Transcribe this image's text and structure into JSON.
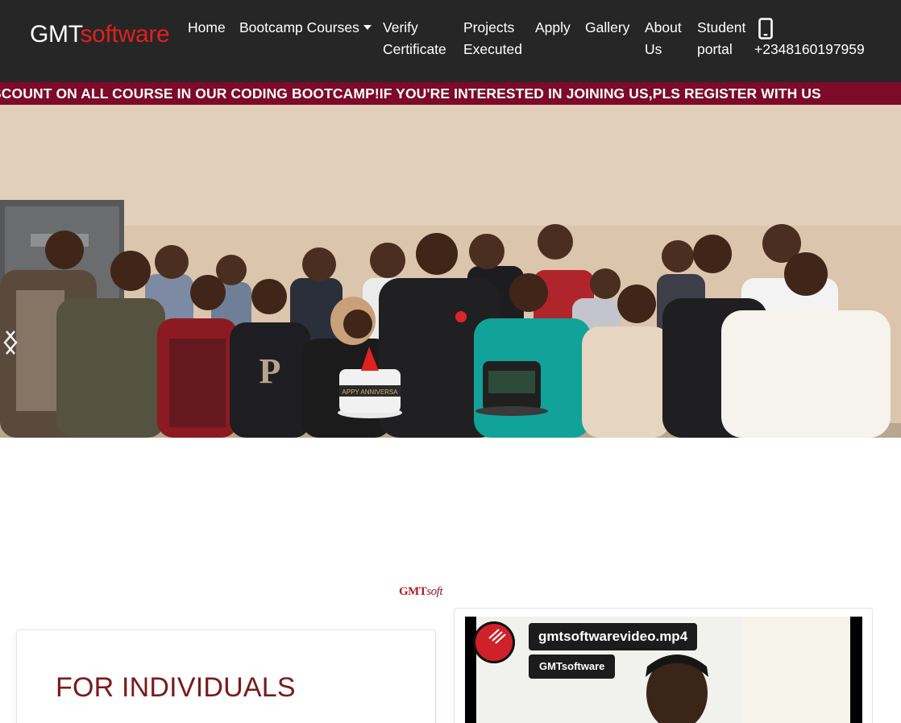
{
  "brand": {
    "part1": "GMT",
    "part2": "software",
    "colors": {
      "white": "#ffffff",
      "accent": "#e0201f"
    }
  },
  "nav": {
    "home": "Home",
    "bootcamp": "Bootcamp Courses",
    "verify_line1": "Verify",
    "verify_line2": "Certificate",
    "projects_line1": "Projects",
    "projects_line2": "Executed",
    "apply": "Apply",
    "gallery": "Gallery",
    "about_line1": "About",
    "about_line2": "Us",
    "portal_line1": "Student",
    "portal_line2": "portal",
    "phone_icon": "mobile-phone-icon",
    "phone": "+2348160197959"
  },
  "marquee": {
    "text": "SCOUNT ON ALL COURSE IN OUR CODING BOOTCAMP!IF YOU'RE INTERESTED IN JOINING US,PLS REGISTER WITH US",
    "bg": "#7c0a28"
  },
  "hero": {
    "cake_text": "APPY ANNIVERSA",
    "prev_icon": "chevron-left-icon",
    "next_icon": "chevron-right-icon"
  },
  "section_logo": {
    "part1": "GMT",
    "part2": "soft"
  },
  "individuals_card": {
    "title": "FOR INDIVIDUALS",
    "color": "#7a1a1c"
  },
  "video": {
    "title": "gmtsoftwarevideo.mp4",
    "channel": "GMTsoftware",
    "avatar_icon": "gmtsoftware-logo-icon"
  }
}
